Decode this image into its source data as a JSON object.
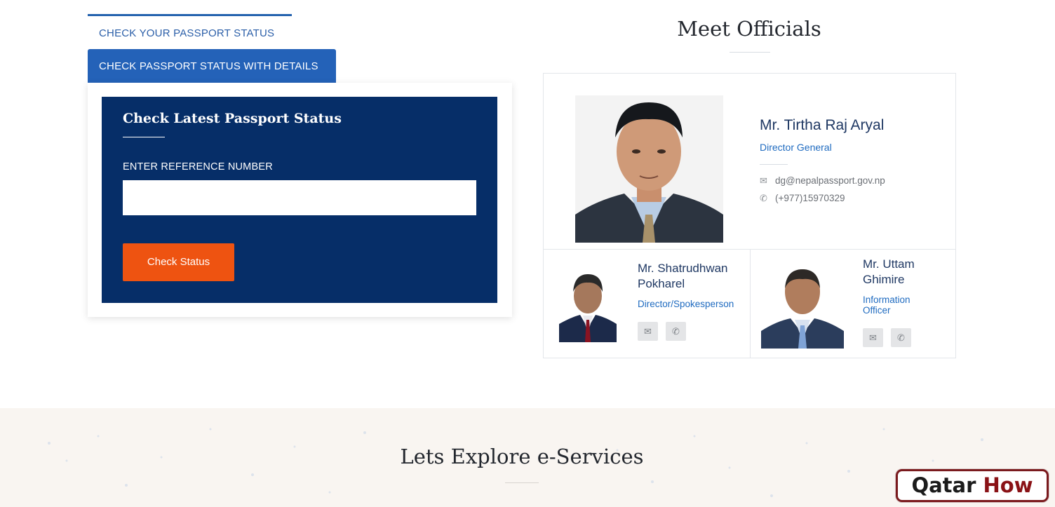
{
  "tabs": {
    "tab1_label": "CHECK YOUR PASSPORT STATUS",
    "tab2_label": "CHECK PASSPORT STATUS WITH DETAILS"
  },
  "status_form": {
    "title": "Check Latest Passport Status",
    "field_label": "ENTER REFERENCE NUMBER",
    "field_value": "",
    "field_placeholder": "",
    "button_label": "Check Status"
  },
  "officials": {
    "section_title": "Meet Officials",
    "main": {
      "name": "Mr. Tirtha Raj Aryal",
      "role": "Director General",
      "email": "dg@nepalpassport.gov.np",
      "phone": "(+977)15970329"
    },
    "second": {
      "name_line1": "Mr. Shatrudhwan",
      "name_line2": "Pokharel",
      "role": "Director/Spokesperson"
    },
    "third": {
      "name_line1": "Mr. Uttam",
      "name_line2": "Ghimire",
      "role_line1": "Information",
      "role_line2": "Officer"
    }
  },
  "explore": {
    "title": "Lets Explore e-Services"
  },
  "watermark": {
    "part1": "Qatar",
    "part2": "How"
  },
  "icons": {
    "email": "envelope-icon",
    "phone": "phone-icon"
  }
}
